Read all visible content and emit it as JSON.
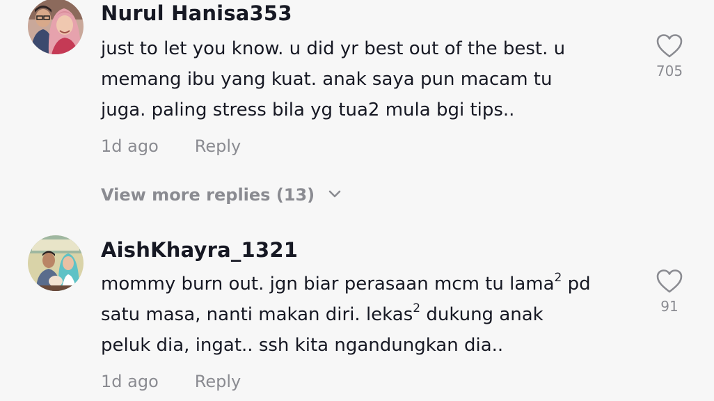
{
  "comments": [
    {
      "username": "Nurul Hanisa353",
      "avatar": "avatar-couple-photo",
      "text_lines": [
        "just to let you know. u did yr best out of the best. u",
        "memang ibu yang kuat. anak saya pun macam tu",
        "juga. paling stress bila yg tua2 mula bgi tips.."
      ],
      "time": "1d ago",
      "reply_label": "Reply",
      "like_count": "705"
    },
    {
      "username": "AishKhayra_1321",
      "avatar": "avatar-family-photo",
      "text_lines": [
        {
          "before": "mommy burn out. jgn biar perasaan mcm tu lama",
          "sup": "2",
          "after": " pd"
        },
        {
          "before": "satu masa, nanti makan diri. lekas",
          "sup": "2",
          "after": " dukung anak"
        },
        {
          "before": "peluk dia, ingat.. ssh kita ngandungkan dia..",
          "sup": "",
          "after": ""
        }
      ],
      "time": "1d ago",
      "reply_label": "Reply",
      "like_count": "91"
    }
  ],
  "view_more": {
    "label": "View more replies (13)",
    "icon": "chevron-down-icon"
  },
  "colors": {
    "background": "#f7f7f7",
    "primary_text": "#161823",
    "secondary_text": "#8a8b91"
  }
}
